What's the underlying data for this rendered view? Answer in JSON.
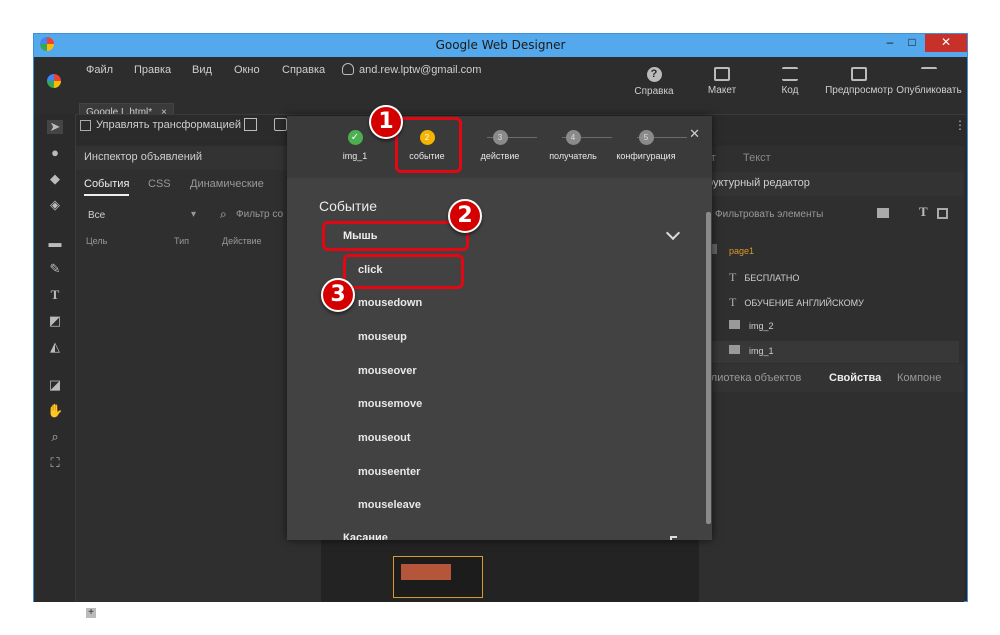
{
  "window": {
    "title": "Google Web Designer",
    "controls": [
      "–",
      "□",
      "✕"
    ]
  },
  "menu": {
    "items": [
      "Файл",
      "Правка",
      "Вид",
      "Окно",
      "Справка"
    ],
    "account": "and.rew.lptw@gmail.com",
    "file_tab": "Google L.html*",
    "help_label": "Справка",
    "right_tools": [
      "Макет",
      "Код",
      "Предпросмотр",
      "Опубликовать"
    ]
  },
  "toolbar": {
    "transform_label": "Управлять трансформацией"
  },
  "left_panel": {
    "title": "Инспектор объявлений",
    "tabs": [
      "События",
      "CSS",
      "Динамические"
    ],
    "filter_select": "Все",
    "filter_placeholder": "Фильтр со",
    "columns": [
      "Цель",
      "Тип",
      "Действие"
    ]
  },
  "right_panel": {
    "tabs_top": [
      "ет",
      "Текст"
    ],
    "title": "руктурный редактор",
    "filter_placeholder": "Фильтровать элементы",
    "tree": [
      {
        "label": "page1",
        "icon": "page-icon"
      },
      {
        "label": "БЕСПЛАТНО",
        "icon": "text-icon"
      },
      {
        "label": "ОБУЧЕНИЕ АНГЛИЙСКОМУ",
        "icon": "text-icon"
      },
      {
        "label": "img_2",
        "icon": "image-icon"
      },
      {
        "label": "img_1",
        "icon": "image-icon"
      }
    ],
    "bottom_tabs": [
      "блиотека объектов",
      "Свойства",
      "Компоне"
    ]
  },
  "wizard": {
    "steps": [
      {
        "number": "✓",
        "label": "img_1",
        "state": "done"
      },
      {
        "number": "2",
        "label": "событие",
        "state": "active"
      },
      {
        "number": "3",
        "label": "действие",
        "state": "pending"
      },
      {
        "number": "4",
        "label": "получатель",
        "state": "pending"
      },
      {
        "number": "5",
        "label": "конфигурация",
        "state": "pending"
      }
    ],
    "section_title": "Событие",
    "groups": [
      {
        "label": "Мышь",
        "chevron": "chevron-down-icon"
      },
      {
        "label": "Касание",
        "chevron": "chevron-up-icon"
      }
    ],
    "events": [
      "click",
      "mousedown",
      "mouseup",
      "mouseover",
      "mousemove",
      "mouseout",
      "mouseenter",
      "mouseleave"
    ],
    "close": "✕"
  },
  "annotations": [
    "1",
    "2",
    "3"
  ],
  "colors": {
    "accent_title": "#53a9ec",
    "active_step": "#f5b400",
    "done_step": "#4caf50",
    "highlight": "#e30613"
  }
}
